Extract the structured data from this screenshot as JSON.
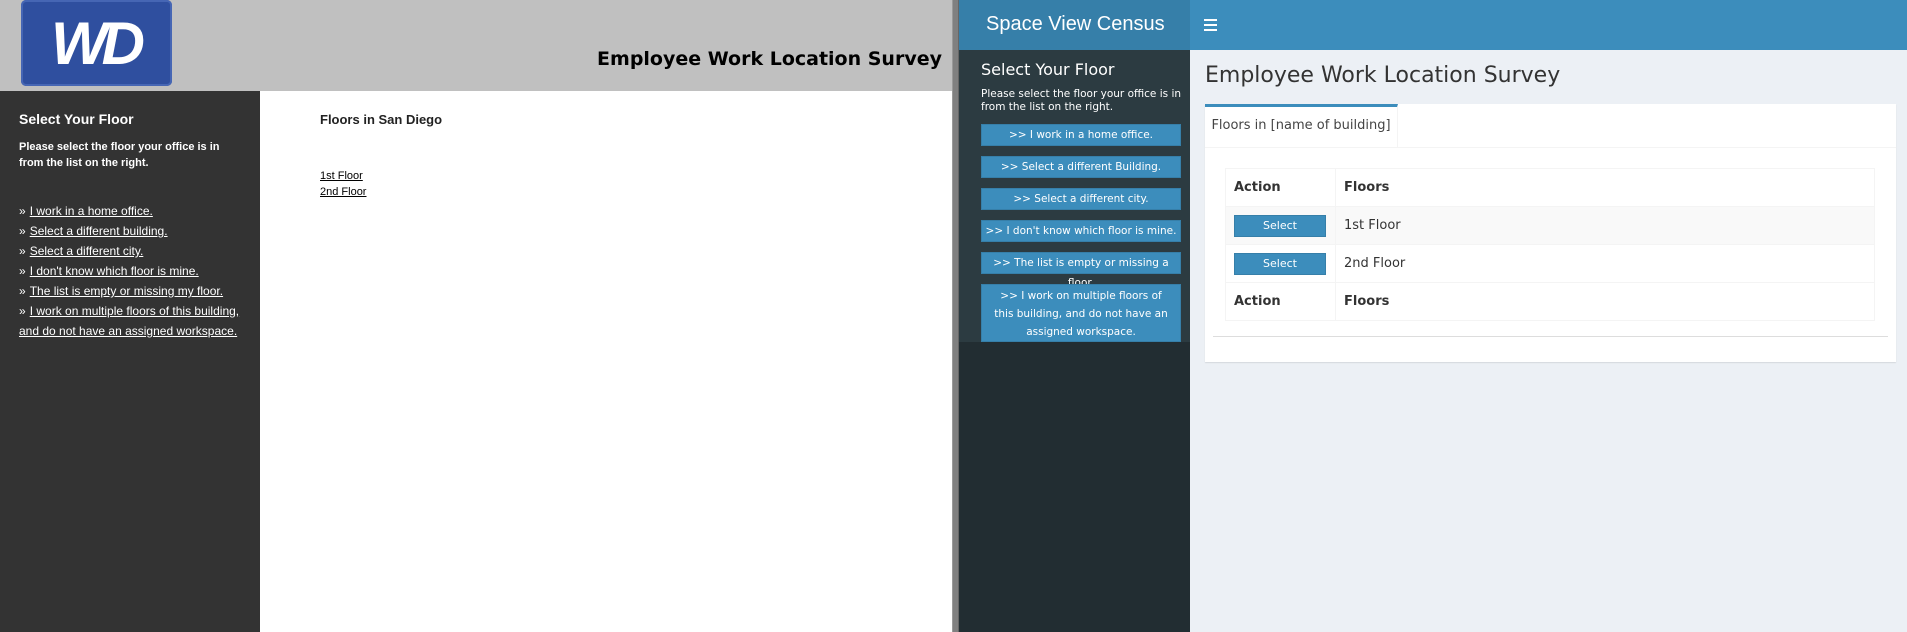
{
  "old_ui": {
    "logo_text": "WD",
    "title": "Employee Work Location Survey",
    "sidebar": {
      "title": "Select Your Floor",
      "description": "Please select the floor your office is in from the list on the right.",
      "links": [
        "I work in a home office.",
        "Select a different building.",
        "Select a different city.",
        "I don't know which floor is mine.",
        "The list is empty or missing my floor.",
        "I work on multiple floors of this building, and do not have an assigned workspace."
      ],
      "bullet": "»"
    },
    "main": {
      "title": "Floors in San Diego",
      "floors": [
        "1st Floor",
        "2nd Floor"
      ]
    }
  },
  "new_ui": {
    "brand": "Space View Census",
    "sidebar": {
      "title": "Select Your Floor",
      "description": "Please select the floor your office is in from the list on the right.",
      "buttons": [
        ">> I work in a home office.",
        ">> Select a different Building.",
        ">> Select a different city.",
        ">> I don't know which floor is mine.",
        ">> The list is empty or missing a floor.",
        ">> I work on multiple floors of this building, and do not have an assigned workspace."
      ]
    },
    "page_title": "Employee Work Location Survey",
    "tab_label": "Floors in [name of building]",
    "table": {
      "headers": [
        "Action",
        "Floors"
      ],
      "rows": [
        {
          "action": "Select",
          "floor": "1st Floor"
        },
        {
          "action": "Select",
          "floor": "2nd Floor"
        }
      ],
      "footers": [
        "Action",
        "Floors"
      ]
    },
    "colors": {
      "topbar": "#3c8dbc",
      "brand": "#367fa9",
      "sidebar": "#222d32",
      "content_bg": "#ecf0f5"
    },
    "menu_icon": "hamburger-icon"
  }
}
